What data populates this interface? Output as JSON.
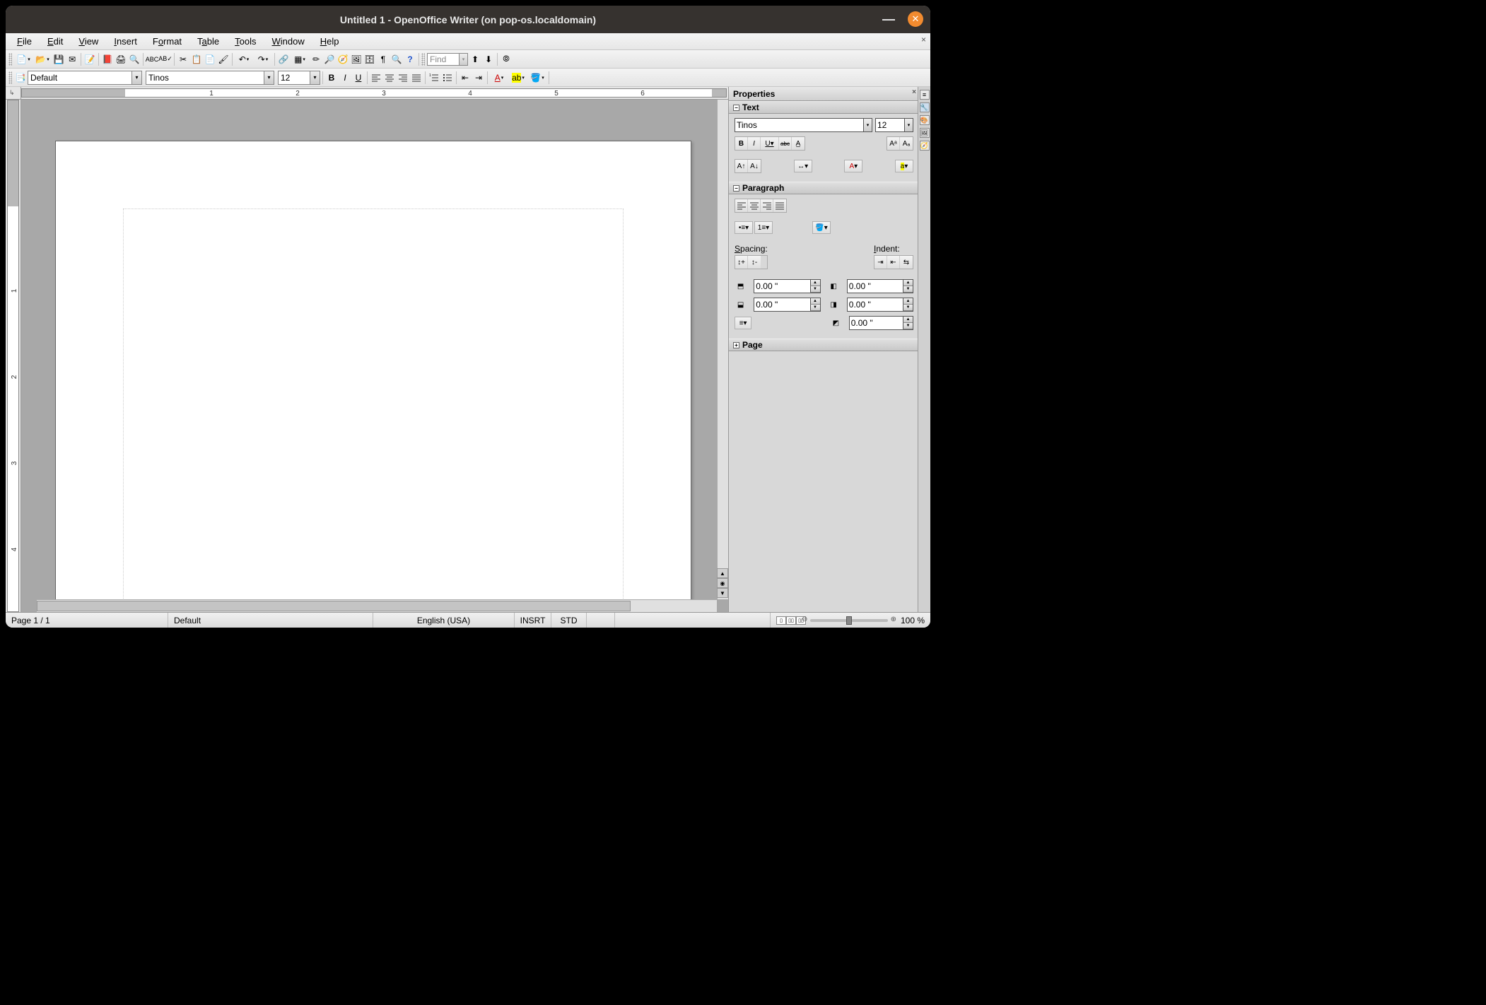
{
  "window": {
    "title": "Untitled 1 - OpenOffice Writer (on pop-os.localdomain)"
  },
  "menubar": {
    "file": "File",
    "edit": "Edit",
    "view": "View",
    "insert": "Insert",
    "format": "Format",
    "table": "Table",
    "tools": "Tools",
    "window": "Window",
    "help": "Help"
  },
  "toolbar1": {
    "find_placeholder": "Find"
  },
  "formatbar": {
    "style": "Default",
    "font": "Tinos",
    "size": "12",
    "bold": "B",
    "italic": "I",
    "underline": "U"
  },
  "ruler": {
    "nums": [
      "1",
      "2",
      "3",
      "4",
      "5",
      "6"
    ]
  },
  "vruler": {
    "nums": [
      "1",
      "2",
      "3",
      "4"
    ]
  },
  "sidebar": {
    "title": "Properties",
    "text": {
      "header": "Text",
      "font": "Tinos",
      "size": "12",
      "bold": "B",
      "italic": "I",
      "underline": "U",
      "strike": "abc"
    },
    "paragraph": {
      "header": "Paragraph",
      "spacing_label": "Spacing:",
      "indent_label": "Indent:",
      "above": "0.00 \"",
      "below": "0.00 \"",
      "indent_before": "0.00 \"",
      "indent_after": "0.00 \"",
      "indent_first": "0.00 \""
    },
    "page": {
      "header": "Page"
    }
  },
  "status": {
    "page": "Page 1 / 1",
    "style": "Default",
    "language": "English (USA)",
    "insert": "INSRT",
    "std": "STD",
    "zoom": "100 %"
  }
}
